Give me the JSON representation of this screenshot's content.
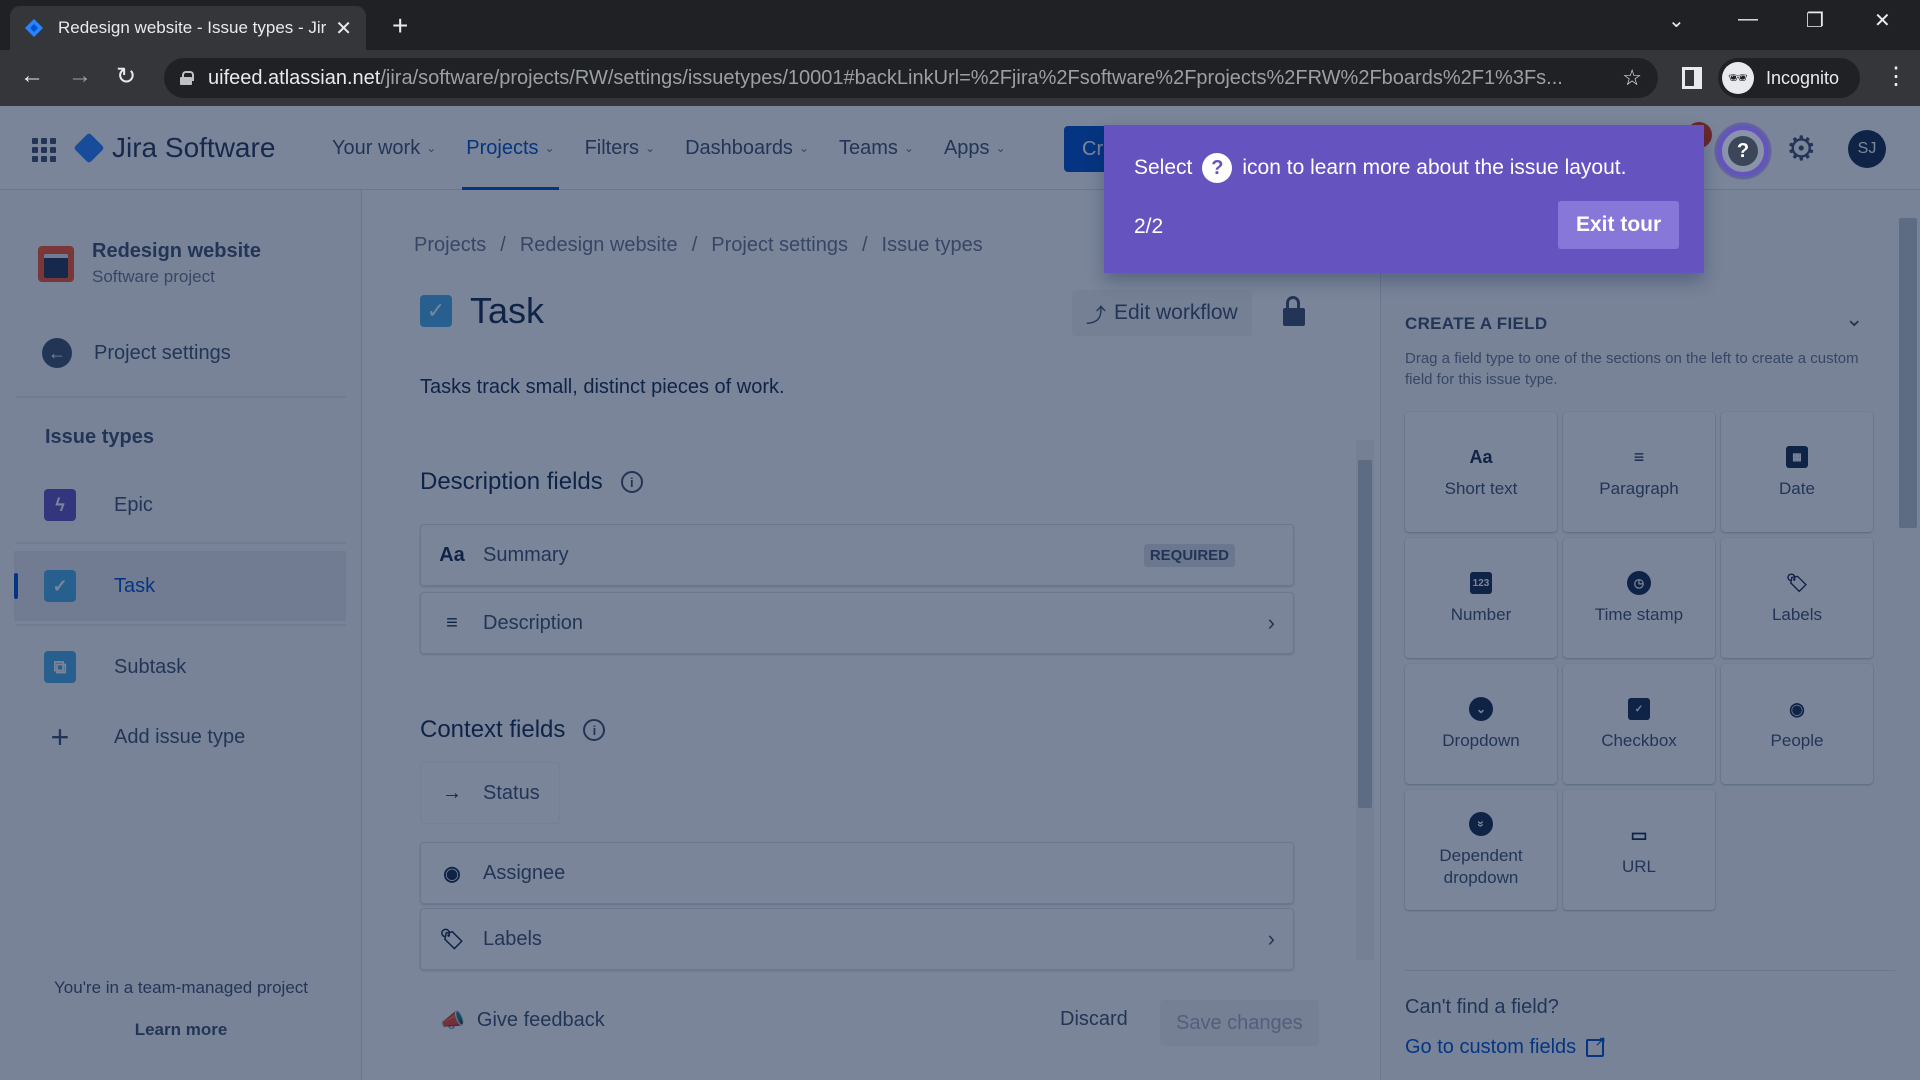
{
  "browser": {
    "tab_title": "Redesign website - Issue types - Jira",
    "new_tab_label": "+",
    "url_host": "uifeed.atlassian.net",
    "url_path": "/jira/software/projects/RW/settings/issuetypes/10001#backLinkUrl=%2Fjira%2Fsoftware%2Fprojects%2FRW%2Fboards%2F1%3Fs...",
    "incognito_label": "Incognito",
    "icons": {
      "back": "←",
      "forward": "→",
      "reload": "↻",
      "star": "☆",
      "kebab": "⋮",
      "tab_list": "⌄",
      "minimize": "—",
      "restore": "❐",
      "close": "✕",
      "incognito": "🕶"
    }
  },
  "topnav": {
    "product": "Jira Software",
    "items": [
      {
        "label": "Your work",
        "active": false
      },
      {
        "label": "Projects",
        "active": true
      },
      {
        "label": "Filters",
        "active": false
      },
      {
        "label": "Dashboards",
        "active": false
      },
      {
        "label": "Teams",
        "active": false
      },
      {
        "label": "Apps",
        "active": false
      }
    ],
    "create_label": "Create",
    "help_glyph": "?",
    "settings_glyph": "⚙",
    "avatar_initials": "SJ"
  },
  "sidebar": {
    "project_name": "Redesign website",
    "project_type": "Software project",
    "back_link": "Project settings",
    "section_heading": "Issue types",
    "issue_types": [
      {
        "label": "Epic",
        "glyph": "ϟ",
        "color": "#6554c0",
        "active": false
      },
      {
        "label": "Task",
        "glyph": "✓",
        "color": "#4bade8",
        "active": true
      },
      {
        "label": "Subtask",
        "glyph": "⧉",
        "color": "#4bade8",
        "active": false
      }
    ],
    "add_label": "Add issue type",
    "footer_text": "You're in a team-managed project",
    "footer_link": "Learn more"
  },
  "main": {
    "breadcrumbs": [
      "Projects",
      "Redesign website",
      "Project settings",
      "Issue types"
    ],
    "title": "Task",
    "edit_workflow_label": "Edit workflow",
    "description": "Tasks track small, distinct pieces of work.",
    "description_section": {
      "title": "Description fields",
      "fields": [
        {
          "icon": "Aa",
          "label": "Summary",
          "badge": "REQUIRED",
          "chevron": ""
        },
        {
          "icon": "≡",
          "label": "Description",
          "badge": "",
          "chevron": "›"
        }
      ]
    },
    "context_section": {
      "title": "Context fields",
      "fields": [
        {
          "icon": "→",
          "label": "Status",
          "chevron": ""
        },
        {
          "icon": "◉",
          "label": "Assignee",
          "chevron": ""
        },
        {
          "icon": "🏷",
          "label": "Labels",
          "chevron": "›"
        }
      ]
    },
    "feedback_label": "Give feedback",
    "discard_label": "Discard",
    "save_label": "Save changes"
  },
  "right_panel": {
    "heading": "CREATE A FIELD",
    "help": "Drag a field type to one of the sections on the left to create a custom field for this issue type.",
    "field_types": [
      {
        "label": "Short text",
        "icon": "Aa"
      },
      {
        "label": "Paragraph",
        "icon": "≡"
      },
      {
        "label": "Date",
        "icon": "▦"
      },
      {
        "label": "Number",
        "icon": "123"
      },
      {
        "label": "Time stamp",
        "icon": "◷"
      },
      {
        "label": "Labels",
        "icon": "🏷"
      },
      {
        "label": "Dropdown",
        "icon": "⌄"
      },
      {
        "label": "Checkbox",
        "icon": "✓"
      },
      {
        "label": "People",
        "icon": "◉"
      },
      {
        "label": "Dependent dropdown",
        "icon": "»"
      },
      {
        "label": "URL",
        "icon": "▭"
      }
    ],
    "cant_find": "Can't find a field?",
    "custom_fields_link": "Go to custom fields"
  },
  "tour": {
    "text_before": "Select",
    "text_after": "icon to learn more about the issue layout.",
    "step": "2/2",
    "exit_label": "Exit tour",
    "accent": "#6554c0"
  }
}
